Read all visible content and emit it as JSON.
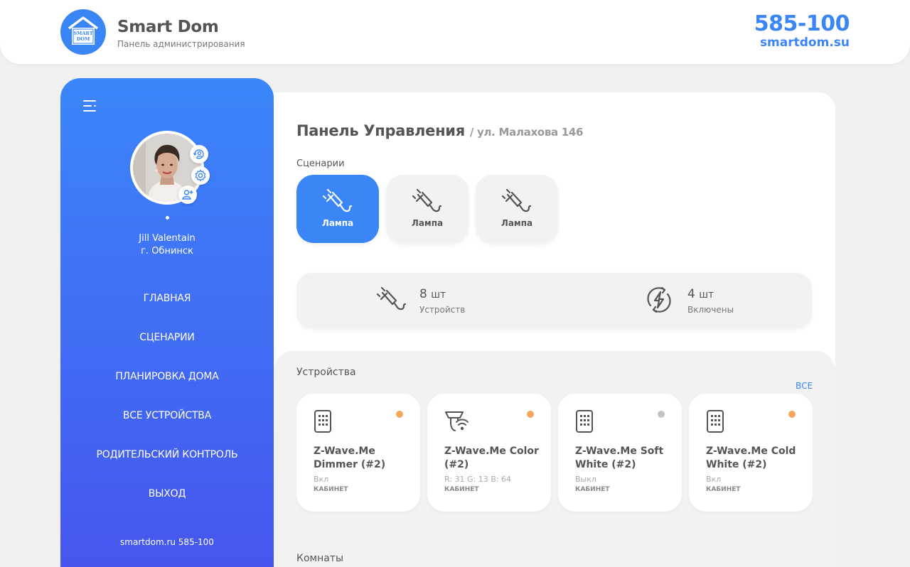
{
  "header": {
    "brand_title": "Smart Dom",
    "brand_subtitle": "Панель администрирования",
    "logo_text_1": "SMART",
    "logo_text_2": "DOM",
    "phone": "585-100",
    "site": "smartdom.su"
  },
  "sidebar": {
    "user_name": "Jill Valentain",
    "user_city": "г. Обнинск",
    "nav": [
      {
        "label": "Главная"
      },
      {
        "label": "Сценарии"
      },
      {
        "label": "Планировка дома"
      },
      {
        "label": "Все устройства"
      },
      {
        "label": "Родительский контроль"
      },
      {
        "label": "Выход"
      }
    ],
    "footer": "smartdom.ru 585-100"
  },
  "main": {
    "title": "Панель Управления",
    "subtitle": "/ ул. Малахова 146",
    "scenarios_label": "Сценарии",
    "scenarios": [
      {
        "label": "Лампа",
        "active": true
      },
      {
        "label": "Лампа",
        "active": false
      },
      {
        "label": "Лампа",
        "active": false
      }
    ],
    "stats": {
      "devices_count": "8",
      "devices_unit": "шт",
      "devices_label": "Устройств",
      "on_count": "4",
      "on_unit": "шт",
      "on_label": "Включены"
    },
    "devices_label": "Устройства",
    "all_link": "ВСЕ",
    "devices": [
      {
        "name": "Z-Wave.Me Dimmer (#2)",
        "state": "Вкл",
        "room": "КАБИНЕТ",
        "status_color": "#f5a85a",
        "icon": "switch-panel-icon"
      },
      {
        "name": "Z-Wave.Me Color (#2)",
        "state": "R: 31 G: 13 B: 64",
        "room": "КАБИНЕТ",
        "status_color": "#f5a85a",
        "icon": "wifi-lamp-icon"
      },
      {
        "name": "Z-Wave.Me Soft White (#2)",
        "state": "Выкл",
        "room": "КАБИНЕТ",
        "status_color": "#c4c4c4",
        "icon": "switch-panel-icon"
      },
      {
        "name": "Z-Wave.Me Cold White (#2)",
        "state": "Вкл",
        "room": "КАБИНЕТ",
        "status_color": "#f5a85a",
        "icon": "switch-panel-icon"
      }
    ],
    "rooms_label": "Комнаты"
  },
  "colors": {
    "accent": "#3a86f7",
    "sidebar_gradient_top": "#3b86fb",
    "sidebar_gradient_bottom": "#4655ee",
    "status_on": "#f5a85a",
    "status_off": "#c4c4c4"
  }
}
